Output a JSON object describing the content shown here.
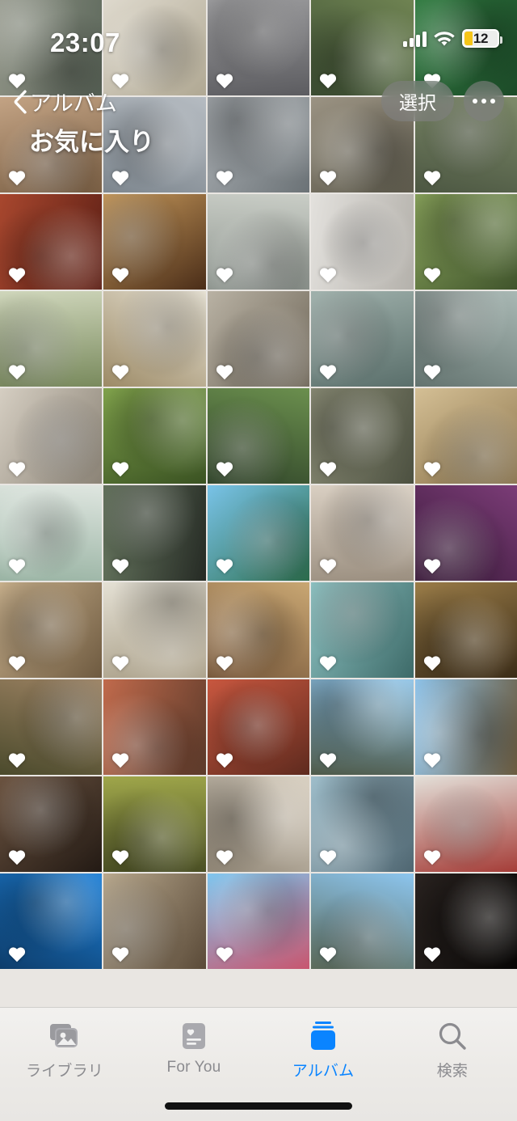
{
  "status_bar": {
    "time": "23:07",
    "cellular_icon": "cellular-bars-icon",
    "wifi_icon": "wifi-icon",
    "battery_percent": "12",
    "battery_low_power_color": "#f5c518"
  },
  "nav": {
    "back_icon": "chevron-left-icon",
    "back_label": "アルバム",
    "title": "お気に入り",
    "select_label": "選択",
    "more_icon": "ellipsis-icon"
  },
  "accent_color": "#0a84ff",
  "grid": {
    "columns": 5,
    "favorite_icon": "heart-icon",
    "photos": [
      {
        "id": 1,
        "label": "aerial-street",
        "c1": "#8d9184",
        "c2": "#5f6a5d"
      },
      {
        "id": 2,
        "label": "food-tray-white",
        "c1": "#ded9cd",
        "c2": "#b0a893"
      },
      {
        "id": 3,
        "label": "person-walking-street",
        "c1": "#9a9a9c",
        "c2": "#5c5c60"
      },
      {
        "id": 4,
        "label": "green-street-trees",
        "c1": "#6f8352",
        "c2": "#3d4f33"
      },
      {
        "id": 5,
        "label": "green-shopfront-sign",
        "c1": "#2f7a3f",
        "c2": "#1c4a28"
      },
      {
        "id": 6,
        "label": "dining-table-rice",
        "c1": "#c3a384",
        "c2": "#7a5f44"
      },
      {
        "id": 7,
        "label": "hochiminh-mausoleum-square",
        "c1": "#b6bcc2",
        "c2": "#7d868e"
      },
      {
        "id": 8,
        "label": "hochiminh-mausoleum-building",
        "c1": "#a9aeb2",
        "c2": "#6b7276"
      },
      {
        "id": 9,
        "label": "temple-of-literature-gate",
        "c1": "#9b9383",
        "c2": "#5d5a4c"
      },
      {
        "id": 10,
        "label": "park-crowd-trees",
        "c1": "#7e8b6a",
        "c2": "#4c5742"
      },
      {
        "id": 11,
        "label": "temple-altar-red",
        "c1": "#a8472e",
        "c2": "#5c1f15"
      },
      {
        "id": 12,
        "label": "vietnamese-egg-coffee",
        "c1": "#c89a5c",
        "c2": "#4a2d18"
      },
      {
        "id": 13,
        "label": "supermarket-aisle",
        "c1": "#c9cdc6",
        "c2": "#8f9690"
      },
      {
        "id": 14,
        "label": "red-ao-dai-display",
        "c1": "#e3e1dd",
        "c2": "#b4b1ab"
      },
      {
        "id": 15,
        "label": "bowl-of-noodles-green",
        "c1": "#8ba65d",
        "c2": "#40542c"
      },
      {
        "id": 16,
        "label": "vnu-university-building",
        "c1": "#cfd6bb",
        "c2": "#798a5d"
      },
      {
        "id": 17,
        "label": "pho-noodle-soup",
        "c1": "#e7e2d4",
        "c2": "#9c8a66"
      },
      {
        "id": 18,
        "label": "temple-entrance-calligraphy",
        "c1": "#b9b2a4",
        "c2": "#6d6557"
      },
      {
        "id": 19,
        "label": "red-bridge-lake",
        "c1": "#9fb0ab",
        "c2": "#5a6f6b"
      },
      {
        "id": 20,
        "label": "lakeside-promenade",
        "c1": "#a9b8b4",
        "c2": "#63736f"
      },
      {
        "id": 21,
        "label": "cho-dong-xuan-market",
        "c1": "#d5cec2",
        "c2": "#8b8376"
      },
      {
        "id": 22,
        "label": "stir-fried-greens-dish",
        "c1": "#7fa14b",
        "c2": "#3a5222"
      },
      {
        "id": 23,
        "label": "garden-pagoda-greenery",
        "c1": "#6b8f4e",
        "c2": "#31462a"
      },
      {
        "id": 24,
        "label": "stilt-house-museum",
        "c1": "#8e9079",
        "c2": "#4c5040"
      },
      {
        "id": 25,
        "label": "ceramic-jars-wall",
        "c1": "#d4bf95",
        "c2": "#8a734a"
      },
      {
        "id": 26,
        "label": "bit-tet-ngoc-hieu-sign",
        "c1": "#dfe6e0",
        "c2": "#9ab4a4"
      },
      {
        "id": 27,
        "label": "hotpot-with-scallions",
        "c1": "#6a7a62",
        "c2": "#252a24"
      },
      {
        "id": 28,
        "label": "beach-resort-palms",
        "c1": "#79c3e8",
        "c2": "#2d6f4e"
      },
      {
        "id": 29,
        "label": "hotel-twin-beds",
        "c1": "#d9cfc2",
        "c2": "#9b8f80"
      },
      {
        "id": 30,
        "label": "purple-menu-card",
        "c1": "#7b3c77",
        "c2": "#3a1a3a"
      },
      {
        "id": 31,
        "label": "table-with-beer-and-plates",
        "c1": "#c8b08c",
        "c2": "#6e5a40"
      },
      {
        "id": 32,
        "label": "plate-of-food-salad",
        "c1": "#e4e0d4",
        "c2": "#a69b83"
      },
      {
        "id": 33,
        "label": "citadel-archway",
        "c1": "#c9a773",
        "c2": "#77573a"
      },
      {
        "id": 34,
        "label": "temple-guardian-statue",
        "c1": "#8fc4c4",
        "c2": "#3d6a68"
      },
      {
        "id": 35,
        "label": "wooden-temple-interior",
        "c1": "#9a7c48",
        "c2": "#3b2c17"
      },
      {
        "id": 36,
        "label": "red-leaf-tree-garden",
        "c1": "#9c8262",
        "c2": "#4b4a2c"
      },
      {
        "id": 37,
        "label": "hand-holding-rambutan-market",
        "c1": "#c06a4c",
        "c2": "#5c3a2a"
      },
      {
        "id": 38,
        "label": "peeled-rambutan-hand",
        "c1": "#c8573f",
        "c2": "#5e2a1e"
      },
      {
        "id": 39,
        "label": "road-to-citadel-gate",
        "c1": "#8fc3e6",
        "c2": "#4e5a4a"
      },
      {
        "id": 40,
        "label": "imperial-city-rooftops",
        "c1": "#8ec2e8",
        "c2": "#6b5b3f"
      },
      {
        "id": 41,
        "label": "dark-market-interior",
        "c1": "#6b5340",
        "c2": "#231a14"
      },
      {
        "id": 42,
        "label": "fruit-market-stall",
        "c1": "#9fa64a",
        "c2": "#4a4f24"
      },
      {
        "id": 43,
        "label": "hand-holding-dragonfruit",
        "c1": "#d8cfc0",
        "c2": "#8f8575"
      },
      {
        "id": 44,
        "label": "tour-boat-window-view",
        "c1": "#9fbecb",
        "c2": "#4f6671"
      },
      {
        "id": 45,
        "label": "iced-milk-drink-cup",
        "c1": "#e3dfd8",
        "c2": "#a53d38"
      },
      {
        "id": 46,
        "label": "blue-curtain-room",
        "c1": "#1d7fd6",
        "c2": "#0d3d6b"
      },
      {
        "id": 47,
        "label": "ornate-temple-gate",
        "c1": "#b9a98e",
        "c2": "#5a4a38"
      },
      {
        "id": 48,
        "label": "pink-castle-building",
        "c1": "#7fc6ef",
        "c2": "#c8566f"
      },
      {
        "id": 49,
        "label": "golden-bridge-hands",
        "c1": "#8cc5ee",
        "c2": "#5c6b5a"
      },
      {
        "id": 50,
        "label": "night-river-lights",
        "c1": "#2a2320",
        "c2": "#070605"
      }
    ]
  },
  "tab_bar": {
    "tabs": [
      {
        "label": "ライブラリ",
        "icon": "photo-stack-icon",
        "active": false
      },
      {
        "label": "For You",
        "icon": "for-you-card-icon",
        "active": false
      },
      {
        "label": "アルバム",
        "icon": "albums-stack-icon",
        "active": true
      },
      {
        "label": "検索",
        "icon": "search-icon",
        "active": false
      }
    ],
    "home_indicator": "home-indicator"
  }
}
